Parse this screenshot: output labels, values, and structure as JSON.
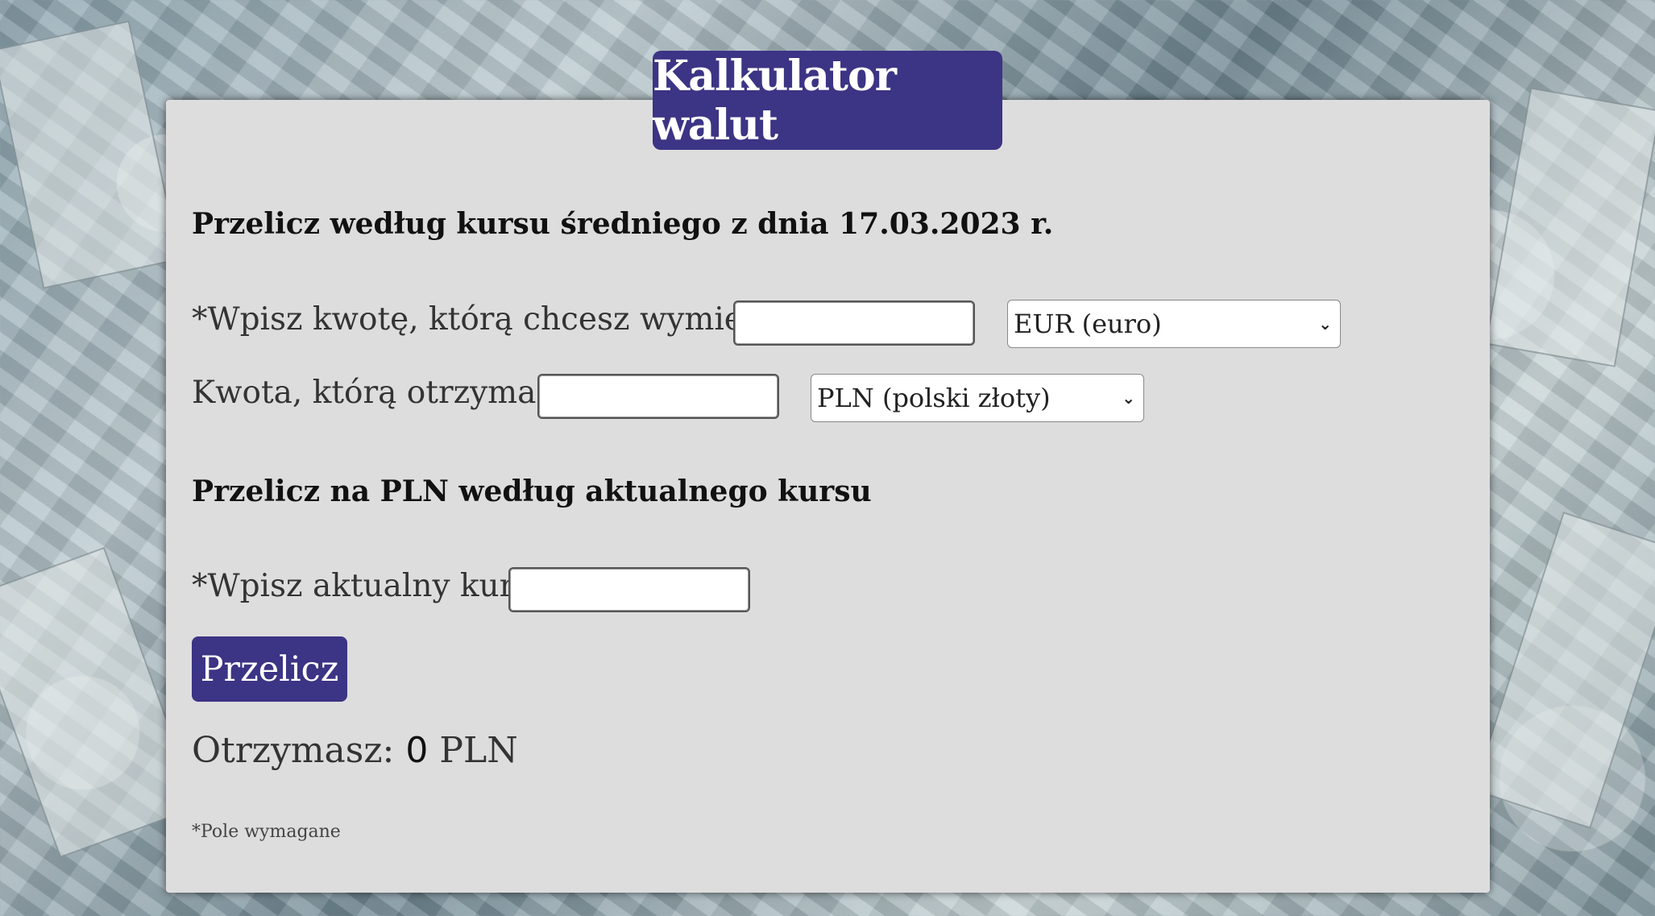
{
  "app": {
    "title": "Kalkulator walut"
  },
  "section_average": {
    "heading": "Przelicz według kursu średniego z dnia 17.03.2023 r.",
    "amount_label": "*Wpisz kwotę, którą chcesz wymienić:",
    "amount_value": "",
    "from_currency": "EUR (euro)",
    "receive_label": "Kwota, którą otrzymasz:",
    "receive_value": "",
    "to_currency": "PLN (polski złoty)"
  },
  "section_current": {
    "heading": "Przelicz na PLN według aktualnego kursu",
    "rate_label": "*Wpisz aktualny kurs:",
    "rate_value": "",
    "button_label": "Przelicz",
    "result_prefix": "Otrzymasz:",
    "result_value": "0",
    "result_currency": "PLN"
  },
  "footer": {
    "required_note": "*Pole wymagane"
  },
  "icons": {
    "select_arrow": "chevron-down-icon"
  },
  "colors": {
    "accent": "#3c3484",
    "card_background": "#dedddd"
  }
}
